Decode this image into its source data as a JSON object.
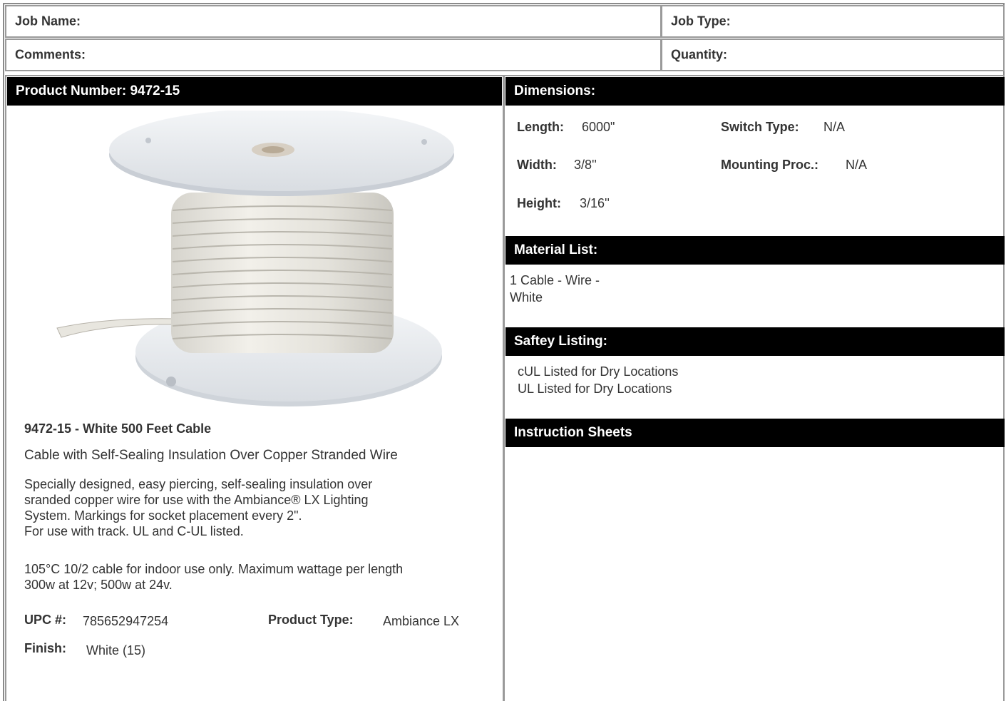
{
  "header": {
    "job_name": "Job Name:",
    "job_type": "Job Type:",
    "comments": "Comments:",
    "quantity": "Quantity:"
  },
  "left": {
    "product_number_bar": "Product Number: 9472-15",
    "image_alt": "cable spool",
    "title": "9472-15 - White 500 Feet Cable",
    "subtitle": "Cable with Self-Sealing Insulation Over Copper Stranded Wire",
    "desc_lines": [
      "Specially designed, easy piercing, self-sealing insulation over",
      "sranded copper wire for use with the Ambiance® LX Lighting",
      "System. Markings for socket placement every 2\".",
      "For use with track. UL and C-UL listed."
    ],
    "spec_lines": [
      "105°C 10/2 cable for indoor use only. Maximum wattage per length",
      "300w at 12v; 500w at 24v."
    ],
    "upc_label": "UPC #:",
    "upc_value": "785652947254",
    "product_type_label": "Product Type:",
    "product_type_value": "Ambiance LX",
    "finish_label": "Finish:",
    "finish_value": "White (15)"
  },
  "right": {
    "dimensions_bar": "Dimensions:",
    "length_label": "Length:",
    "length_value": "6000\"",
    "width_label": "Width:",
    "width_value": "3/8''",
    "height_label": "Height:",
    "height_value": "3/16''",
    "switch_label": "Switch Type:",
    "switch_value": "N/A",
    "mounting_label": "Mounting Proc.:",
    "mounting_value": "N/A",
    "material_bar": "Material List:",
    "material_lines": [
      "1 Cable - Wire -",
      "White"
    ],
    "safety_bar": "Saftey Listing:",
    "safety_lines": [
      "cUL Listed for Dry Locations",
      "UL Listed for Dry Locations"
    ],
    "instruction_bar": "Instruction Sheets"
  }
}
